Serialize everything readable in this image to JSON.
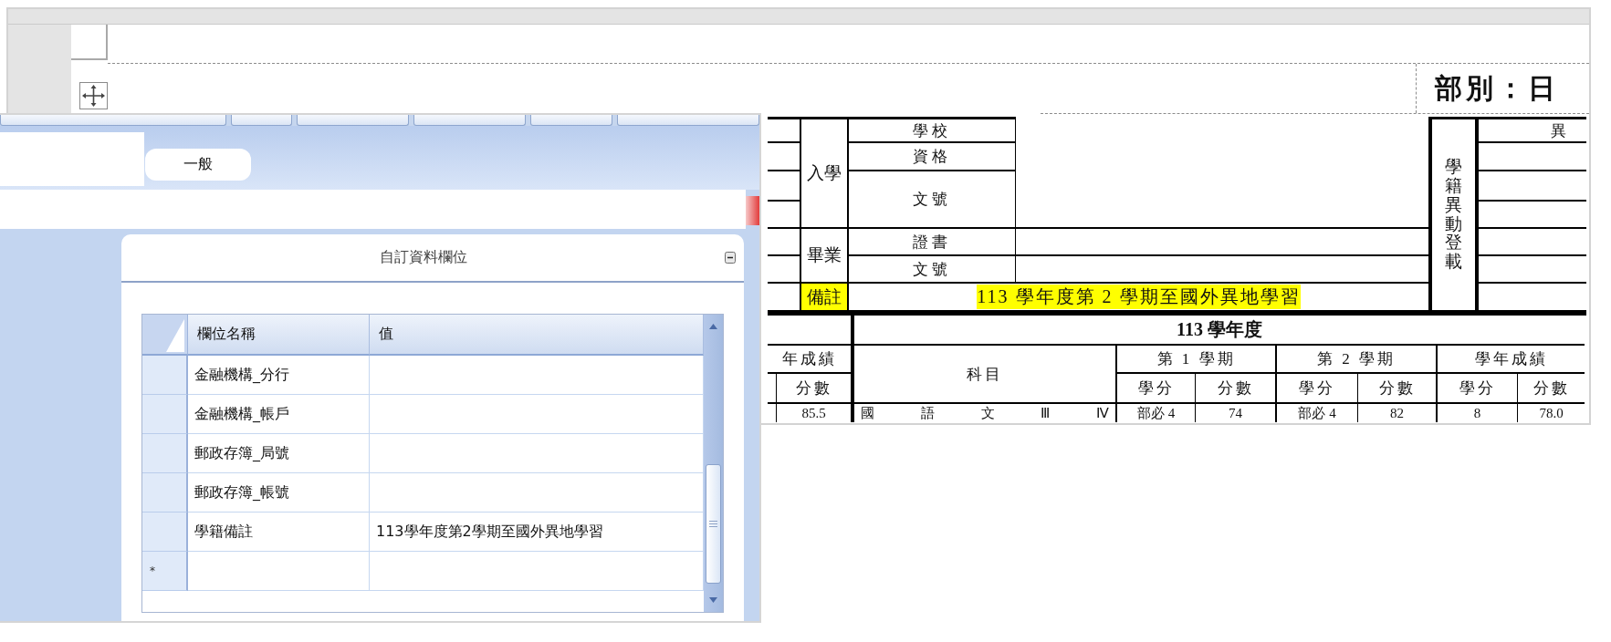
{
  "designer": {
    "department_label": "部別：日"
  },
  "report_form": {
    "admission": {
      "label": "入學",
      "fields": [
        "學校",
        "資格",
        "文號"
      ]
    },
    "graduation": {
      "label": "畢業",
      "fields": [
        "證書",
        "文號"
      ]
    },
    "remarks": {
      "label": "備註",
      "value": "113 學年度第 2 學期至國外異地學習",
      "highlighted": true
    },
    "status_change": {
      "label": "學籍異動登載",
      "column_heading": "異"
    },
    "grades": {
      "previous_year": {
        "heading": "年成績",
        "score_heading": "分數"
      },
      "year_heading": "113 學年度",
      "subject_heading": "科目",
      "periods": [
        {
          "label": "第 1 學期",
          "credit_heading": "學分",
          "score_heading": "分數"
        },
        {
          "label": "第 2 學期",
          "credit_heading": "學分",
          "score_heading": "分數"
        },
        {
          "label": "學年成績",
          "credit_heading": "學分",
          "score_heading": "分數"
        }
      ],
      "rows": [
        {
          "previous_score": "85.5",
          "subject": "國 語 文 Ⅲ Ⅳ",
          "periods": [
            {
              "credit": "部必 4",
              "score": "74"
            },
            {
              "credit": "部必 4",
              "score": "82"
            },
            {
              "credit": "8",
              "score": "78.0"
            }
          ]
        }
      ]
    }
  },
  "dialog": {
    "tabs": [
      {
        "label": "一般",
        "selected": true
      }
    ],
    "panel": {
      "title": "自訂資料欄位",
      "expanded": true,
      "grid": {
        "columns": [
          "欄位名稱",
          "值"
        ],
        "rows": [
          {
            "name": "金融機構_分行"
          },
          {
            "name": "金融機構_帳戶"
          },
          {
            "name": "郵政存簿_局號"
          },
          {
            "name": "郵政存簿_帳號"
          },
          {
            "name": "學籍備註",
            "value": "113學年度第2學期至國外異地學習"
          }
        ],
        "new_row_marker": "*"
      }
    }
  }
}
